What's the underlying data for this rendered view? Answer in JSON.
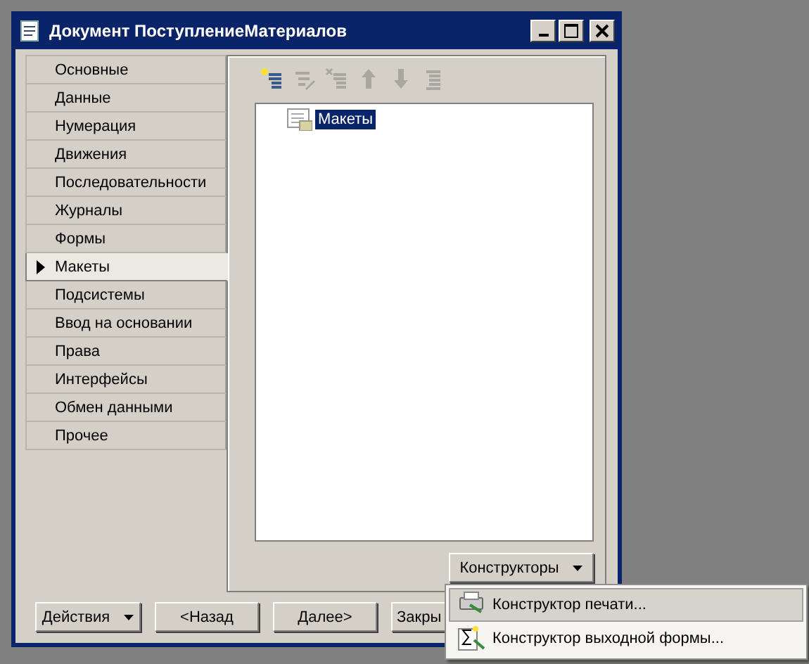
{
  "window": {
    "title": "Документ ПоступлениеМатериалов"
  },
  "tabs": [
    {
      "label": "Основные",
      "selected": false
    },
    {
      "label": "Данные",
      "selected": false
    },
    {
      "label": "Нумерация",
      "selected": false
    },
    {
      "label": "Движения",
      "selected": false
    },
    {
      "label": "Последовательности",
      "selected": false
    },
    {
      "label": "Журналы",
      "selected": false
    },
    {
      "label": "Формы",
      "selected": false
    },
    {
      "label": "Макеты",
      "selected": true
    },
    {
      "label": "Подсистемы",
      "selected": false
    },
    {
      "label": "Ввод на основании",
      "selected": false
    },
    {
      "label": "Права",
      "selected": false
    },
    {
      "label": "Интерфейсы",
      "selected": false
    },
    {
      "label": "Обмен данными",
      "selected": false
    },
    {
      "label": "Прочее",
      "selected": false
    }
  ],
  "toolbar": [
    {
      "kind": "add",
      "disabled": false
    },
    {
      "kind": "edit",
      "disabled": true
    },
    {
      "kind": "delete",
      "disabled": true
    },
    {
      "kind": "up",
      "disabled": true
    },
    {
      "kind": "down",
      "disabled": true
    },
    {
      "kind": "sort",
      "disabled": true
    }
  ],
  "tree": [
    {
      "label": "Макеты",
      "selected": true
    }
  ],
  "constructors_button": {
    "label": "Конструкторы"
  },
  "menu": [
    {
      "kind": "print",
      "label": "Конструктор печати...",
      "selected": true
    },
    {
      "kind": "output",
      "label": "Конструктор выходной формы...",
      "selected": false
    }
  ],
  "buttons": [
    {
      "label": "Действия",
      "dropdown": true
    },
    {
      "label": "<Назад",
      "dropdown": false
    },
    {
      "label": "Далее>",
      "dropdown": false
    },
    {
      "label": "Закры",
      "dropdown": false
    }
  ]
}
